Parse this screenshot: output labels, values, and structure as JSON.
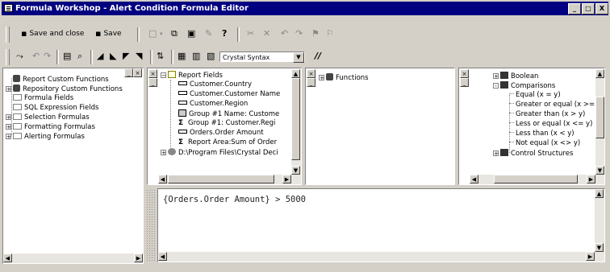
{
  "window": {
    "title": "Formula Workshop - Alert Condition Formula Editor",
    "controls": [
      "_",
      "□",
      "X"
    ]
  },
  "toolbar1": {
    "save_close_label": "Save and close",
    "save_label": "Save",
    "buttons": [
      "new-icon",
      "dropdown-icon",
      "copy-icon",
      "properties-icon",
      "pencil-icon",
      "help-icon",
      "cut-icon",
      "delete-icon",
      "undo-icon",
      "redo-icon",
      "bookmark-icon",
      "bookmark-next-icon"
    ]
  },
  "toolbar2": {
    "syntax_value": "Crystal Syntax",
    "comment_label": "//"
  },
  "workshop_tree": {
    "items": [
      {
        "label": "Report Custom Functions",
        "expander": ""
      },
      {
        "label": "Repository Custom Functions",
        "expander": "+"
      },
      {
        "label": "Formula Fields",
        "expander": ""
      },
      {
        "label": "SQL Expression Fields",
        "expander": ""
      },
      {
        "label": "Selection Formulas",
        "expander": "+"
      },
      {
        "label": "Formatting Formulas",
        "expander": "+"
      },
      {
        "label": "Alerting Formulas",
        "expander": "+"
      }
    ]
  },
  "fields_tree": {
    "root": "Report Fields",
    "items": [
      {
        "label": "Customer.Country",
        "icon": "field"
      },
      {
        "label": "Customer.Customer Name",
        "icon": "field"
      },
      {
        "label": "Customer.Region",
        "icon": "field"
      },
      {
        "label": "Group #1 Name: Custome",
        "icon": "group"
      },
      {
        "label": "Group #1: Customer.Regi",
        "icon": "sum"
      },
      {
        "label": "Orders.Order Amount",
        "icon": "field"
      },
      {
        "label": "Report Area:Sum of Order",
        "icon": "sum"
      }
    ],
    "db": "D:\\Program Files\\Crystal Deci"
  },
  "functions_tree": {
    "root": "Functions"
  },
  "operators_tree": {
    "items": [
      {
        "label": "Boolean",
        "expander": "+",
        "depth": 0
      },
      {
        "label": "Comparisons",
        "expander": "-",
        "depth": 0
      },
      {
        "label": "Equal (x = y)",
        "expander": "",
        "depth": 1
      },
      {
        "label": "Greater or equal (x >= y",
        "expander": "",
        "depth": 1
      },
      {
        "label": "Greater than (x > y)",
        "expander": "",
        "depth": 1
      },
      {
        "label": "Less or equal (x <= y)",
        "expander": "",
        "depth": 1
      },
      {
        "label": "Less than (x < y)",
        "expander": "",
        "depth": 1
      },
      {
        "label": "Not equal (x <> y)",
        "expander": "",
        "depth": 1
      },
      {
        "label": "Control Structures",
        "expander": "+",
        "depth": 0
      }
    ]
  },
  "editor": {
    "formula": "{Orders.Order Amount} > 5000"
  }
}
